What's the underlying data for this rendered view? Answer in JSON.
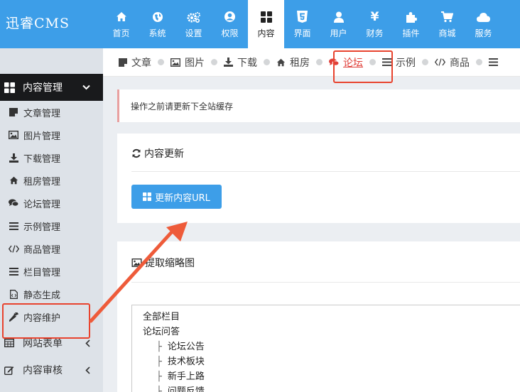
{
  "app": {
    "logo": "迅睿CMS"
  },
  "topnav": [
    {
      "label": "首页",
      "icon": "home-icon",
      "active": false
    },
    {
      "label": "系统",
      "icon": "globe-icon",
      "active": false
    },
    {
      "label": "设置",
      "icon": "gears-icon",
      "active": false
    },
    {
      "label": "权限",
      "icon": "user-circle-icon",
      "active": false
    },
    {
      "label": "内容",
      "icon": "grid-icon",
      "active": true
    },
    {
      "label": "界面",
      "icon": "html5-icon",
      "active": false
    },
    {
      "label": "用户",
      "icon": "user-icon",
      "active": false
    },
    {
      "label": "财务",
      "icon": "yen-icon",
      "active": false
    },
    {
      "label": "插件",
      "icon": "puzzle-icon",
      "active": false
    },
    {
      "label": "商城",
      "icon": "cart-icon",
      "active": false
    },
    {
      "label": "服务",
      "icon": "cloud-icon",
      "active": false
    }
  ],
  "sidebar": {
    "group_open": {
      "label": "内容管理",
      "icon": "grid-icon"
    },
    "items": [
      {
        "label": "文章管理",
        "icon": "article-icon"
      },
      {
        "label": "图片管理",
        "icon": "image-icon"
      },
      {
        "label": "下载管理",
        "icon": "download-icon"
      },
      {
        "label": "租房管理",
        "icon": "home-icon"
      },
      {
        "label": "论坛管理",
        "icon": "comments-icon"
      },
      {
        "label": "示例管理",
        "icon": "list-icon"
      },
      {
        "label": "商品管理",
        "icon": "code-icon"
      },
      {
        "label": "栏目管理",
        "icon": "list-icon"
      },
      {
        "label": "静态生成",
        "icon": "file-code-icon"
      },
      {
        "label": "内容维护",
        "icon": "wrench-icon"
      }
    ],
    "groups_closed": [
      {
        "label": "网站表单",
        "icon": "table-icon"
      },
      {
        "label": "内容审核",
        "icon": "edit-icon"
      }
    ]
  },
  "subtabs": [
    {
      "label": "文章",
      "icon": "article-icon",
      "active": false
    },
    {
      "label": "图片",
      "icon": "image-icon",
      "active": false
    },
    {
      "label": "下载",
      "icon": "download-icon",
      "active": false
    },
    {
      "label": "租房",
      "icon": "home-icon",
      "active": false
    },
    {
      "label": "论坛",
      "icon": "comments-icon",
      "active": true
    },
    {
      "label": "示例",
      "icon": "list-icon",
      "active": false
    },
    {
      "label": "商品",
      "icon": "code-icon",
      "active": false
    }
  ],
  "notice": "操作之前请更新下全站缓存",
  "panel_update": {
    "title": "内容更新",
    "button": "更新内容URL"
  },
  "panel_thumb": {
    "title": "提取缩略图",
    "tree": [
      {
        "label": "全部栏目",
        "level": 0
      },
      {
        "label": "论坛问答",
        "level": 0
      },
      {
        "label": "论坛公告",
        "level": 1
      },
      {
        "label": "技术板块",
        "level": 1
      },
      {
        "label": "新手上路",
        "level": 1
      },
      {
        "label": "问题反馈",
        "level": 1
      }
    ],
    "branch_glyph": "├"
  },
  "colors": {
    "topbar": "#3d9ee8",
    "sidebar": "#dde2e8",
    "sidebar_active": "#191a1c",
    "accent_red": "#e8432e",
    "button": "#3d9ee8"
  }
}
